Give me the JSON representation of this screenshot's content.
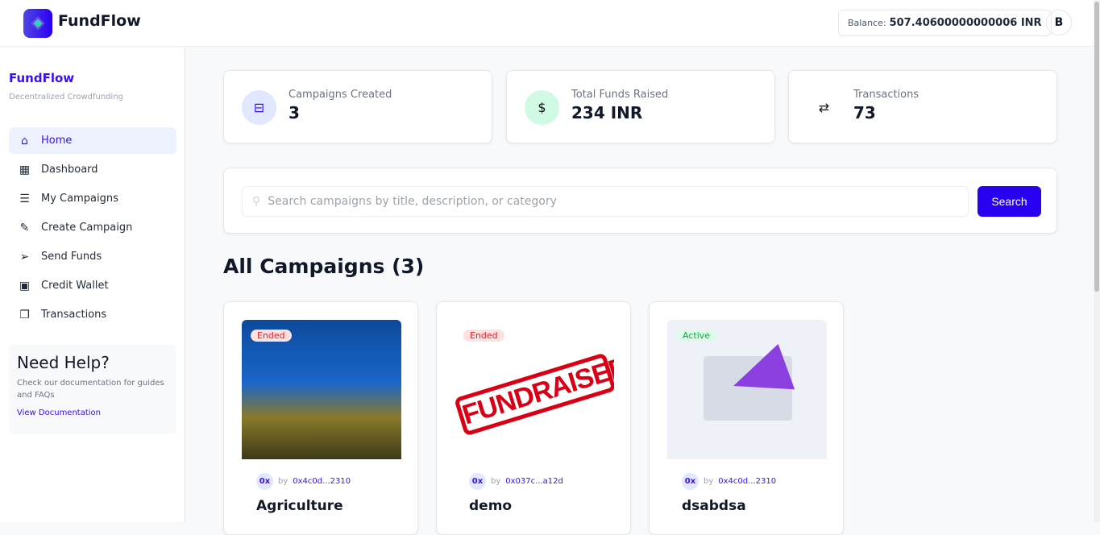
{
  "header": {
    "brand": "FundFlow",
    "balance_label": "Balance:",
    "balance_value": "507.40600000000006 INR",
    "avatar": "B"
  },
  "sidebar": {
    "title": "FundFlow",
    "subtitle": "Decentralized Crowdfunding",
    "items": [
      {
        "label": "Home",
        "icon": "home-icon"
      },
      {
        "label": "Dashboard",
        "icon": "dashboard-icon"
      },
      {
        "label": "My Campaigns",
        "icon": "list-icon"
      },
      {
        "label": "Create Campaign",
        "icon": "pencil-icon"
      },
      {
        "label": "Send Funds",
        "icon": "send-icon"
      },
      {
        "label": "Credit Wallet",
        "icon": "wallet-icon"
      },
      {
        "label": "Transactions",
        "icon": "copy-icon"
      }
    ],
    "help": {
      "title": "Need Help?",
      "text": "Check our documentation for guides and FAQs",
      "link": "View Documentation"
    }
  },
  "stats": [
    {
      "label": "Campaigns Created",
      "value": "3"
    },
    {
      "label": "Total Funds Raised",
      "value": "234 INR"
    },
    {
      "label": "Transactions",
      "value": "73"
    }
  ],
  "search": {
    "placeholder": "Search campaigns by title, description, or category",
    "button": "Search"
  },
  "campaigns_heading": "All Campaigns (3)",
  "campaigns": [
    {
      "status": "Ended",
      "avatar": "0x",
      "by": "by",
      "owner": "0x4c0d...2310",
      "title": "Agriculture"
    },
    {
      "status": "Ended",
      "avatar": "0x",
      "by": "by",
      "owner": "0x037c...a12d",
      "title": "demo",
      "image_text": "FUNDRAISER"
    },
    {
      "status": "Active",
      "avatar": "0x",
      "by": "by",
      "owner": "0x4c0d...2310",
      "title": "dsabdsa"
    }
  ],
  "colors": {
    "accent": "#2a00f0",
    "ended": "#dc2626",
    "active": "#16a34a"
  }
}
